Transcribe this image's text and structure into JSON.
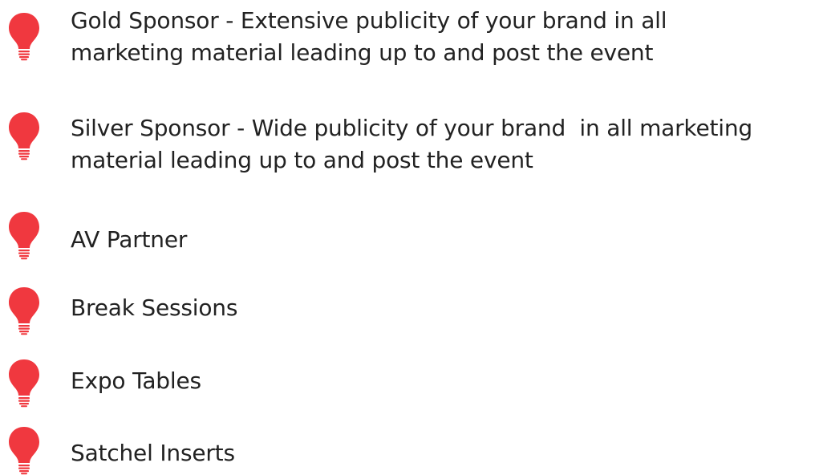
{
  "bullet_icon": "lightbulb-icon",
  "accent_color": "#f0383f",
  "items": [
    {
      "label": "Gold Sponsor - Extensive publicity of your brand in all\nmarketing material leading up to and post the event"
    },
    {
      "label": "Silver Sponsor - Wide publicity of your brand  in all marketing\nmaterial leading up to and post the event"
    },
    {
      "label": "AV Partner"
    },
    {
      "label": "Break Sessions"
    },
    {
      "label": "Expo Tables"
    },
    {
      "label": "Satchel Inserts"
    }
  ]
}
